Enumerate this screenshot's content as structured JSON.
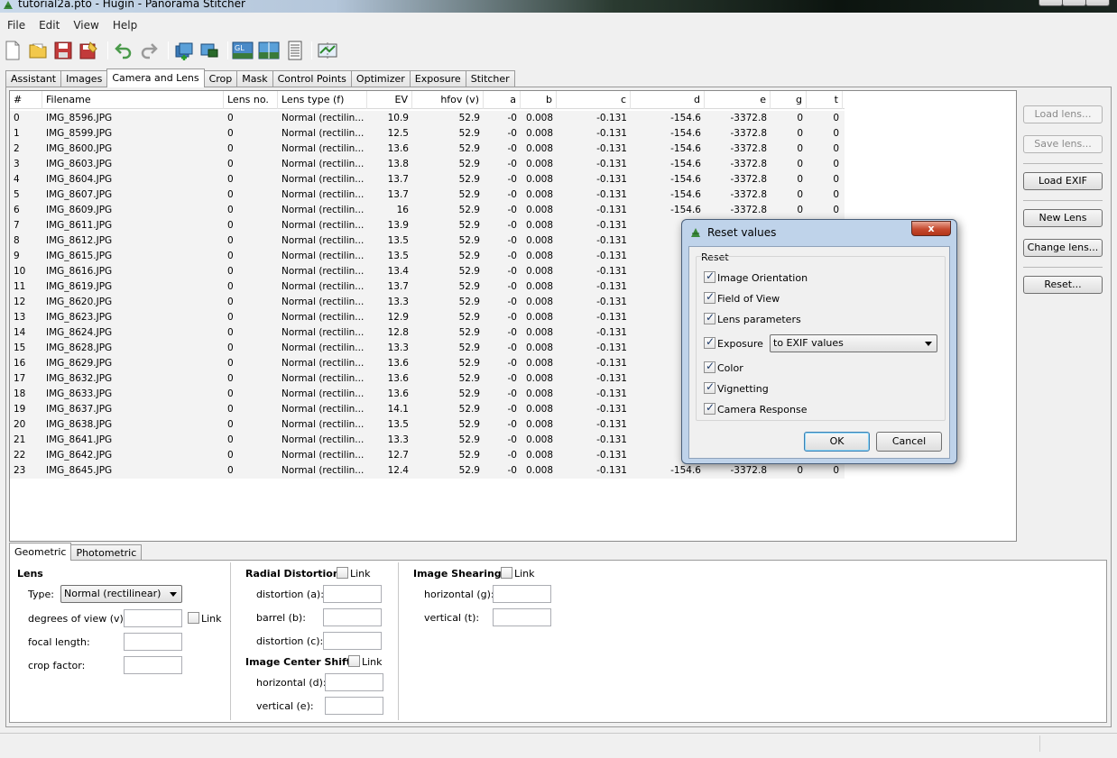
{
  "window": {
    "title": "tutorial2a.pto - Hugin - Panorama Stitcher"
  },
  "menu": [
    "File",
    "Edit",
    "View",
    "Help"
  ],
  "toolbar": {
    "icons": [
      "new-file-icon",
      "open-folder-icon",
      "save-icon",
      "save-as-icon",
      "undo-icon",
      "redo-icon",
      "add-images-icon",
      "add-series-icon",
      "gl-preview-icon",
      "preview-icon",
      "control-point-table-icon",
      "optimize-icon"
    ],
    "gl_label": "GL"
  },
  "main_tabs": [
    {
      "label": "Assistant",
      "active": false
    },
    {
      "label": "Images",
      "active": false
    },
    {
      "label": "Camera and Lens",
      "active": true
    },
    {
      "label": "Crop",
      "active": false
    },
    {
      "label": "Mask",
      "active": false
    },
    {
      "label": "Control Points",
      "active": false
    },
    {
      "label": "Optimizer",
      "active": false
    },
    {
      "label": "Exposure",
      "active": false
    },
    {
      "label": "Stitcher",
      "active": false
    }
  ],
  "table": {
    "columns": [
      "#",
      "Filename",
      "Lens no.",
      "Lens type (f)",
      "EV",
      "hfov (v)",
      "a",
      "b",
      "c",
      "d",
      "e",
      "g",
      "t"
    ],
    "rows": [
      [
        "0",
        "IMG_8596.JPG",
        "0",
        "Normal (rectilin...",
        "10.9",
        "52.9",
        "-0",
        "0.008",
        "-0.131",
        "-154.6",
        "-3372.8",
        "0",
        "0"
      ],
      [
        "1",
        "IMG_8599.JPG",
        "0",
        "Normal (rectilin...",
        "12.5",
        "52.9",
        "-0",
        "0.008",
        "-0.131",
        "-154.6",
        "-3372.8",
        "0",
        "0"
      ],
      [
        "2",
        "IMG_8600.JPG",
        "0",
        "Normal (rectilin...",
        "13.6",
        "52.9",
        "-0",
        "0.008",
        "-0.131",
        "-154.6",
        "-3372.8",
        "0",
        "0"
      ],
      [
        "3",
        "IMG_8603.JPG",
        "0",
        "Normal (rectilin...",
        "13.8",
        "52.9",
        "-0",
        "0.008",
        "-0.131",
        "-154.6",
        "-3372.8",
        "0",
        "0"
      ],
      [
        "4",
        "IMG_8604.JPG",
        "0",
        "Normal (rectilin...",
        "13.7",
        "52.9",
        "-0",
        "0.008",
        "-0.131",
        "-154.6",
        "-3372.8",
        "0",
        "0"
      ],
      [
        "5",
        "IMG_8607.JPG",
        "0",
        "Normal (rectilin...",
        "13.7",
        "52.9",
        "-0",
        "0.008",
        "-0.131",
        "-154.6",
        "-3372.8",
        "0",
        "0"
      ],
      [
        "6",
        "IMG_8609.JPG",
        "0",
        "Normal (rectilin...",
        "16",
        "52.9",
        "-0",
        "0.008",
        "-0.131",
        "-154.6",
        "-3372.8",
        "0",
        "0"
      ],
      [
        "7",
        "IMG_8611.JPG",
        "0",
        "Normal (rectilin...",
        "13.9",
        "52.9",
        "-0",
        "0.008",
        "-0.131",
        "-15",
        "",
        "",
        ""
      ],
      [
        "8",
        "IMG_8612.JPG",
        "0",
        "Normal (rectilin...",
        "13.5",
        "52.9",
        "-0",
        "0.008",
        "-0.131",
        "-15",
        "",
        "",
        ""
      ],
      [
        "9",
        "IMG_8615.JPG",
        "0",
        "Normal (rectilin...",
        "13.5",
        "52.9",
        "-0",
        "0.008",
        "-0.131",
        "-15",
        "",
        "",
        ""
      ],
      [
        "10",
        "IMG_8616.JPG",
        "0",
        "Normal (rectilin...",
        "13.4",
        "52.9",
        "-0",
        "0.008",
        "-0.131",
        "-15",
        "",
        "",
        ""
      ],
      [
        "11",
        "IMG_8619.JPG",
        "0",
        "Normal (rectilin...",
        "13.7",
        "52.9",
        "-0",
        "0.008",
        "-0.131",
        "-15",
        "",
        "",
        ""
      ],
      [
        "12",
        "IMG_8620.JPG",
        "0",
        "Normal (rectilin...",
        "13.3",
        "52.9",
        "-0",
        "0.008",
        "-0.131",
        "-15",
        "",
        "",
        ""
      ],
      [
        "13",
        "IMG_8623.JPG",
        "0",
        "Normal (rectilin...",
        "12.9",
        "52.9",
        "-0",
        "0.008",
        "-0.131",
        "-15",
        "",
        "",
        ""
      ],
      [
        "14",
        "IMG_8624.JPG",
        "0",
        "Normal (rectilin...",
        "12.8",
        "52.9",
        "-0",
        "0.008",
        "-0.131",
        "-15",
        "",
        "",
        ""
      ],
      [
        "15",
        "IMG_8628.JPG",
        "0",
        "Normal (rectilin...",
        "13.3",
        "52.9",
        "-0",
        "0.008",
        "-0.131",
        "-15",
        "",
        "",
        ""
      ],
      [
        "16",
        "IMG_8629.JPG",
        "0",
        "Normal (rectilin...",
        "13.6",
        "52.9",
        "-0",
        "0.008",
        "-0.131",
        "-15",
        "",
        "",
        ""
      ],
      [
        "17",
        "IMG_8632.JPG",
        "0",
        "Normal (rectilin...",
        "13.6",
        "52.9",
        "-0",
        "0.008",
        "-0.131",
        "-15",
        "",
        "",
        ""
      ],
      [
        "18",
        "IMG_8633.JPG",
        "0",
        "Normal (rectilin...",
        "13.6",
        "52.9",
        "-0",
        "0.008",
        "-0.131",
        "-15",
        "",
        "",
        ""
      ],
      [
        "19",
        "IMG_8637.JPG",
        "0",
        "Normal (rectilin...",
        "14.1",
        "52.9",
        "-0",
        "0.008",
        "-0.131",
        "-15",
        "",
        "",
        ""
      ],
      [
        "20",
        "IMG_8638.JPG",
        "0",
        "Normal (rectilin...",
        "13.5",
        "52.9",
        "-0",
        "0.008",
        "-0.131",
        "-15",
        "",
        "",
        ""
      ],
      [
        "21",
        "IMG_8641.JPG",
        "0",
        "Normal (rectilin...",
        "13.3",
        "52.9",
        "-0",
        "0.008",
        "-0.131",
        "-15",
        "",
        "",
        ""
      ],
      [
        "22",
        "IMG_8642.JPG",
        "0",
        "Normal (rectilin...",
        "12.7",
        "52.9",
        "-0",
        "0.008",
        "-0.131",
        "-15",
        "",
        "",
        ""
      ],
      [
        "23",
        "IMG_8645.JPG",
        "0",
        "Normal (rectilin...",
        "12.4",
        "52.9",
        "-0",
        "0.008",
        "-0.131",
        "-154.6",
        "-3372.8",
        "0",
        "0"
      ]
    ]
  },
  "right_buttons": {
    "load_lens": "Load lens...",
    "save_lens": "Save lens...",
    "load_exif": "Load EXIF",
    "new_lens": "New Lens",
    "change_lens": "Change lens...",
    "reset": "Reset..."
  },
  "lower_tabs": [
    {
      "label": "Geometric",
      "active": true
    },
    {
      "label": "Photometric",
      "active": false
    }
  ],
  "geometric": {
    "lens": {
      "title": "Lens",
      "type_label": "Type:",
      "type_value": "Normal (rectilinear)",
      "dov_label": "degrees of view (v):",
      "link_label": "Link",
      "focal_label": "focal length:",
      "crop_label": "crop factor:"
    },
    "radial": {
      "title": "Radial Distortion",
      "link_label": "Link",
      "a_label": "distortion (a):",
      "b_label": "barrel (b):",
      "c_label": "distortion (c):"
    },
    "center": {
      "title": "Image Center Shift",
      "link_label": "Link",
      "d_label": "horizontal (d):",
      "e_label": "vertical (e):"
    },
    "shear": {
      "title": "Image Shearing",
      "link_label": "Link",
      "g_label": "horizontal (g):",
      "t_label": "vertical (t):"
    }
  },
  "dialog": {
    "title": "Reset values",
    "close_label": "x",
    "group_label": "Reset",
    "options": [
      {
        "label": "Image Orientation",
        "checked": true
      },
      {
        "label": "Field of View",
        "checked": true
      },
      {
        "label": "Lens parameters",
        "checked": true
      },
      {
        "label": "Exposure",
        "checked": true
      },
      {
        "label": "Color",
        "checked": true
      },
      {
        "label": "Vignetting",
        "checked": true
      },
      {
        "label": "Camera Response",
        "checked": true
      }
    ],
    "exposure_select": "to EXIF values",
    "ok_label": "OK",
    "cancel_label": "Cancel"
  },
  "colors": {
    "accent": "#3c7fb1",
    "dialog_frame": "#bfd3ea",
    "close_button": "#c64a2f"
  }
}
